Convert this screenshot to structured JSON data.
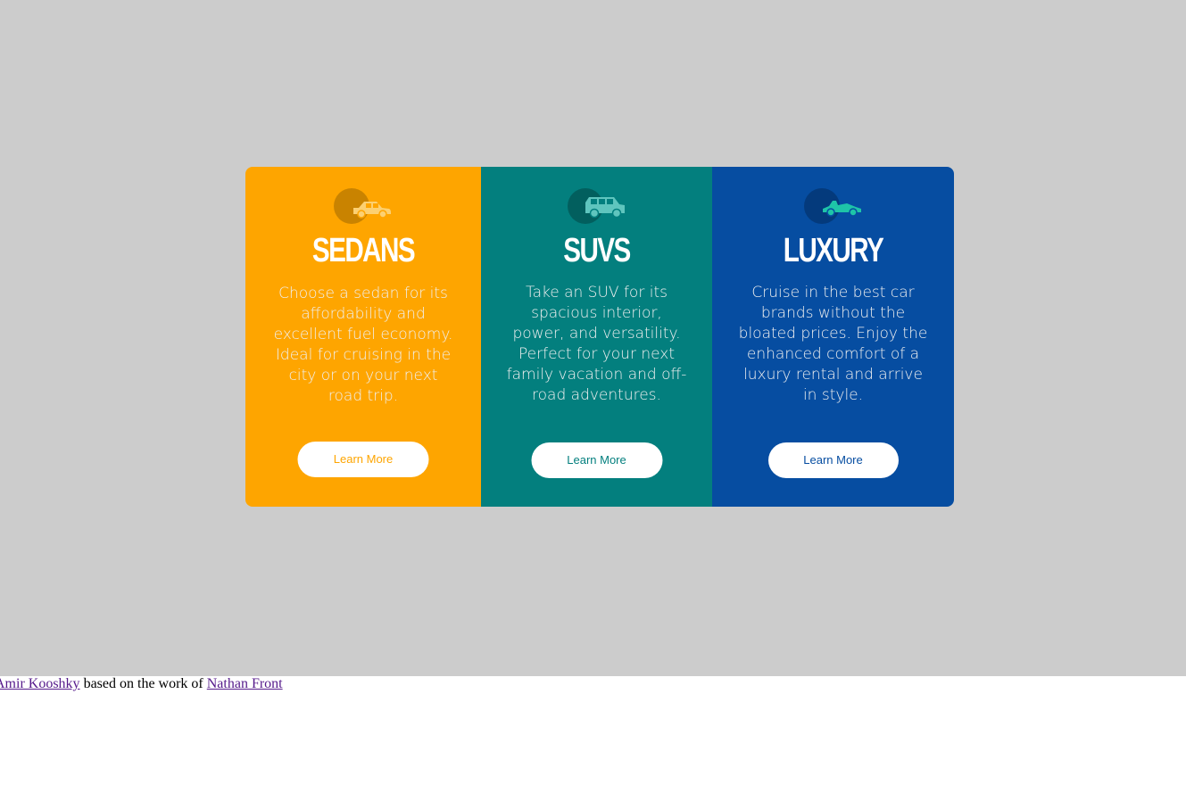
{
  "cards": [
    {
      "title": "SEDANS",
      "description": "Choose a sedan for its affordability and excellent fuel economy. Ideal for cruising in the city or on your next road trip.",
      "button_label": "Learn More",
      "icon": "sedan-car-icon",
      "color": "#fea500"
    },
    {
      "title": "SUVS",
      "description": "Take an SUV for its spacious interior, power, and versatility. Perfect for your next family vacation and off-road adventures.",
      "button_label": "Learn More",
      "icon": "suv-car-icon",
      "color": "#037f7e"
    },
    {
      "title": "LUXURY",
      "description": "Cruise in the best car brands without the bloated prices. Enjoy the enhanced comfort of a luxury rental and arrive in style.",
      "button_label": "Learn More",
      "icon": "luxury-car-icon",
      "color": "#064da1"
    }
  ],
  "footer": {
    "author_link": "Amir Kooshky",
    "middle_text": " based on the work of ",
    "credit_link": "Nathan Front"
  },
  "colors": {
    "page_background": "#cccccc",
    "link": "#551a8b"
  }
}
